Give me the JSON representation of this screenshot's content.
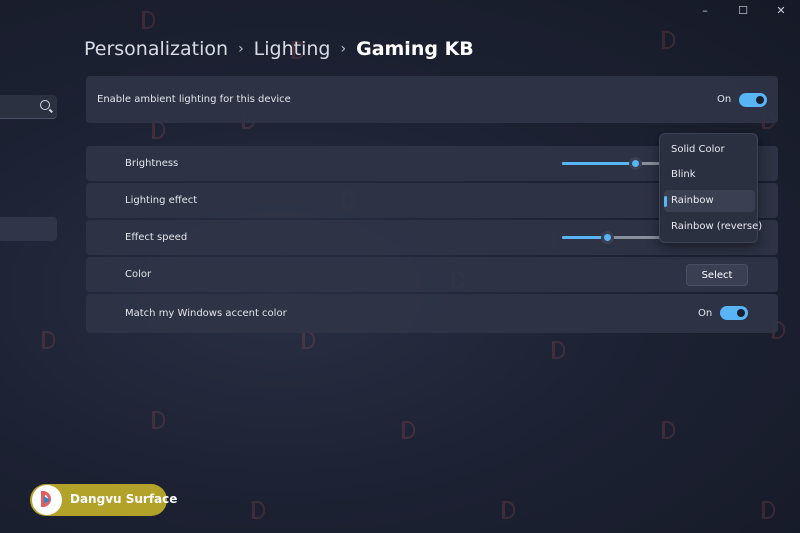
{
  "window_controls": {
    "minimize": "–",
    "maximize": "☐",
    "close": "✕"
  },
  "breadcrumb": [
    "Personalization",
    "Lighting",
    "Gaming KB"
  ],
  "ambient": {
    "label": "Enable ambient lighting for this device",
    "state": "On",
    "on": true
  },
  "settings": {
    "brightness": {
      "label": "Brightness",
      "value_fraction": 0.73
    },
    "effect": {
      "label": "Lighting effect"
    },
    "speed": {
      "label": "Effect speed",
      "value_fraction": 0.45
    },
    "color": {
      "label": "Color",
      "button": "Select"
    },
    "accent": {
      "label": "Match my Windows accent color",
      "state": "On",
      "on": true
    }
  },
  "effect_menu": {
    "options": [
      "Solid Color",
      "Blink",
      "Rainbow",
      "Rainbow (reverse)"
    ],
    "selected": "Rainbow"
  },
  "watermark": {
    "brand": "Dangvu Surface",
    "color": "#b3a22a"
  },
  "colors": {
    "accent": "#59b4f5",
    "card": "#2f3446",
    "background": "#1d2234"
  }
}
